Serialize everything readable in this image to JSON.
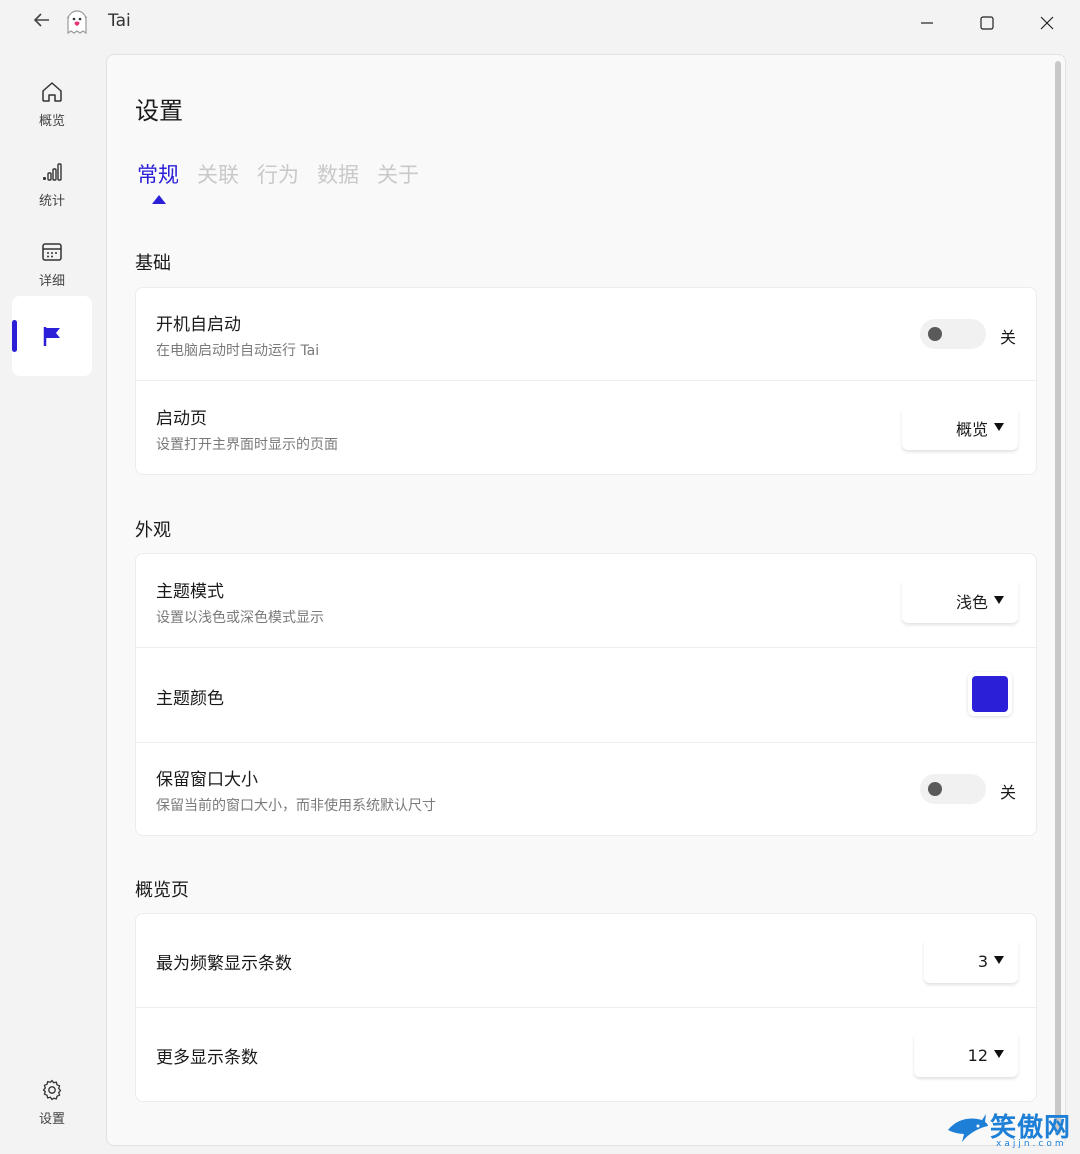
{
  "window": {
    "title": "Tai",
    "back_icon": "back-arrow-icon",
    "logo_icon": "ghost-logo-icon",
    "controls": [
      "minimize-icon",
      "maximize-icon",
      "close-icon"
    ]
  },
  "sidebar": {
    "items": [
      {
        "label": "概览",
        "icon": "home-icon"
      },
      {
        "label": "统计",
        "icon": "bar-chart-icon"
      },
      {
        "label": "详细",
        "icon": "calendar-icon"
      },
      {
        "label": "",
        "icon": "flag-icon",
        "active": true
      }
    ],
    "settings": {
      "label": "设置",
      "icon": "gear-icon"
    }
  },
  "page": {
    "title": "设置",
    "tabs": [
      {
        "label": "常规",
        "active": true
      },
      {
        "label": "关联"
      },
      {
        "label": "行为"
      },
      {
        "label": "数据"
      },
      {
        "label": "关于"
      }
    ]
  },
  "sections": {
    "basic": {
      "title": "基础",
      "autostart": {
        "title": "开机自启动",
        "desc": "在电脑启动时自动运行 Tai",
        "state": "关",
        "on": false
      },
      "startpage": {
        "title": "启动页",
        "desc": "设置打开主界面时显示的页面",
        "value": "概览"
      }
    },
    "appearance": {
      "title": "外观",
      "theme_mode": {
        "title": "主题模式",
        "desc": "设置以浅色或深色模式显示",
        "value": "浅色"
      },
      "theme_color": {
        "title": "主题颜色",
        "color": "#2b1fd8"
      },
      "keep_size": {
        "title": "保留窗口大小",
        "desc": "保留当前的窗口大小，而非使用系统默认尺寸",
        "state": "关",
        "on": false
      }
    },
    "overview": {
      "title": "概览页",
      "frequent_count": {
        "title": "最为频繁显示条数",
        "value": "3"
      },
      "more_count": {
        "title": "更多显示条数",
        "value": "12"
      }
    }
  },
  "watermark": {
    "text": "笑傲网",
    "sub": "xajjn.com"
  },
  "colors": {
    "accent": "#2b1fd8",
    "background": "#f3f3f3",
    "card": "#ffffff"
  }
}
